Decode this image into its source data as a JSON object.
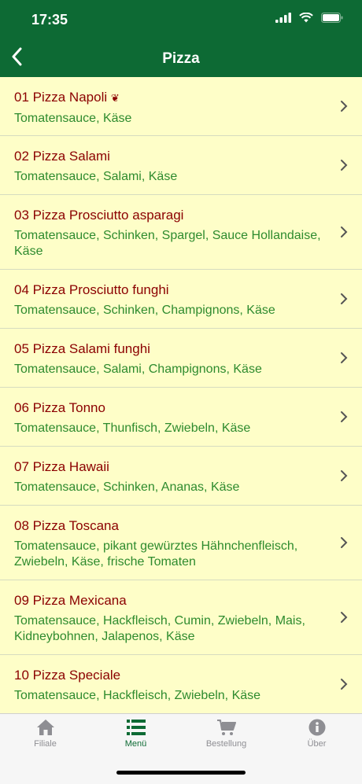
{
  "status": {
    "time": "17:35"
  },
  "nav": {
    "title": "Pizza"
  },
  "items": [
    {
      "title": "01 Pizza Napoli",
      "badge": "❦",
      "desc": "Tomatensauce, Käse"
    },
    {
      "title": "02 Pizza Salami",
      "desc": "Tomatensauce, Salami, Käse"
    },
    {
      "title": "03 Pizza Prosciutto asparagi",
      "desc": "Tomatensauce, Schinken, Spargel, Sauce Hollandaise, Käse"
    },
    {
      "title": "04 Pizza Prosciutto funghi",
      "desc": "Tomatensauce, Schinken, Champignons, Käse"
    },
    {
      "title": "05 Pizza Salami funghi",
      "desc": "Tomatensauce, Salami, Champignons, Käse"
    },
    {
      "title": "06 Pizza Tonno",
      "desc": "Tomatensauce, Thunfisch, Zwiebeln, Käse"
    },
    {
      "title": "07 Pizza Hawaii",
      "desc": "Tomatensauce, Schinken, Ananas, Käse"
    },
    {
      "title": "08 Pizza Toscana",
      "desc": "Tomatensauce, pikant gewürztes Hähnchenfleisch, Zwiebeln, Käse, frische Tomaten"
    },
    {
      "title": "09 Pizza Mexicana",
      "desc": "Tomatensauce, Hackfleisch, Cumin, Zwiebeln, Mais, Kidneybohnen, Jalapenos, Käse"
    },
    {
      "title": "10 Pizza Speciale",
      "desc": "Tomatensauce, Hackfleisch, Zwiebeln, Käse"
    }
  ],
  "tabs": [
    {
      "label": "Filiale",
      "icon": "home-icon"
    },
    {
      "label": "Menü",
      "icon": "list-icon"
    },
    {
      "label": "Bestellung",
      "icon": "cart-icon"
    },
    {
      "label": "Über",
      "icon": "info-icon"
    }
  ],
  "colors": {
    "header": "#0d6a34",
    "background": "#fefec8",
    "title": "#8b0000",
    "description": "#2e8b2e",
    "tab_active": "#0d6a34",
    "tab_inactive": "#8e8e93"
  }
}
